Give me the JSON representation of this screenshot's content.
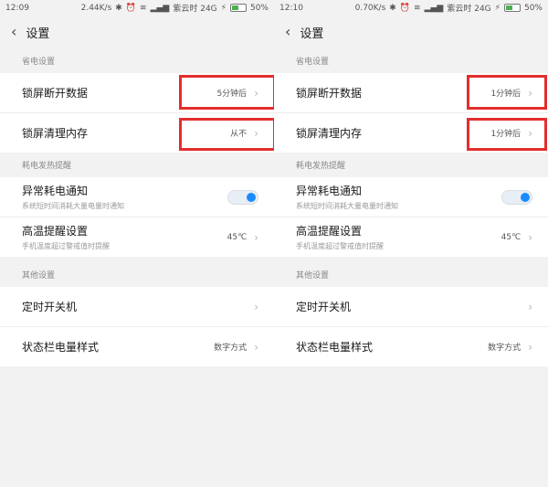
{
  "panels": [
    {
      "status": {
        "time": "12:09",
        "speed": "2.44K/s",
        "carrier": "紫云时 24G",
        "battery": "50%",
        "battery_level": 50
      },
      "header": {
        "title": "设置"
      },
      "sections": [
        {
          "label": "省电设置",
          "items": [
            {
              "title": "锁屏断开数据",
              "value": "5分钟后"
            },
            {
              "title": "锁屏清理内存",
              "value": "从不"
            }
          ]
        },
        {
          "label": "耗电发热提醒",
          "items": [
            {
              "title": "异常耗电通知",
              "subtitle": "系统短时间消耗大量电量时通知",
              "toggle": true
            },
            {
              "title": "高温提醒设置",
              "subtitle": "手机温度超过警戒值时提醒",
              "value": "45℃"
            }
          ]
        },
        {
          "label": "其他设置",
          "items": [
            {
              "title": "定时开关机",
              "value": ""
            },
            {
              "title": "状态栏电量样式",
              "value": "数字方式"
            }
          ]
        }
      ]
    },
    {
      "status": {
        "time": "12:10",
        "speed": "0.70K/s",
        "carrier": "紫云时 24G",
        "battery": "50%",
        "battery_level": 50
      },
      "header": {
        "title": "设置"
      },
      "sections": [
        {
          "label": "省电设置",
          "items": [
            {
              "title": "锁屏断开数据",
              "value": "1分钟后"
            },
            {
              "title": "锁屏清理内存",
              "value": "1分钟后"
            }
          ]
        },
        {
          "label": "耗电发热提醒",
          "items": [
            {
              "title": "异常耗电通知",
              "subtitle": "系统短时间消耗大量电量时通知",
              "toggle": true
            },
            {
              "title": "高温提醒设置",
              "subtitle": "手机温度超过警戒值时提醒",
              "value": "45℃"
            }
          ]
        },
        {
          "label": "其他设置",
          "items": [
            {
              "title": "定时开关机",
              "value": ""
            },
            {
              "title": "状态栏电量样式",
              "value": "数字方式"
            }
          ]
        }
      ]
    }
  ],
  "colors": {
    "highlight": "#e32d2d",
    "toggle_on": "#1a8cff"
  }
}
